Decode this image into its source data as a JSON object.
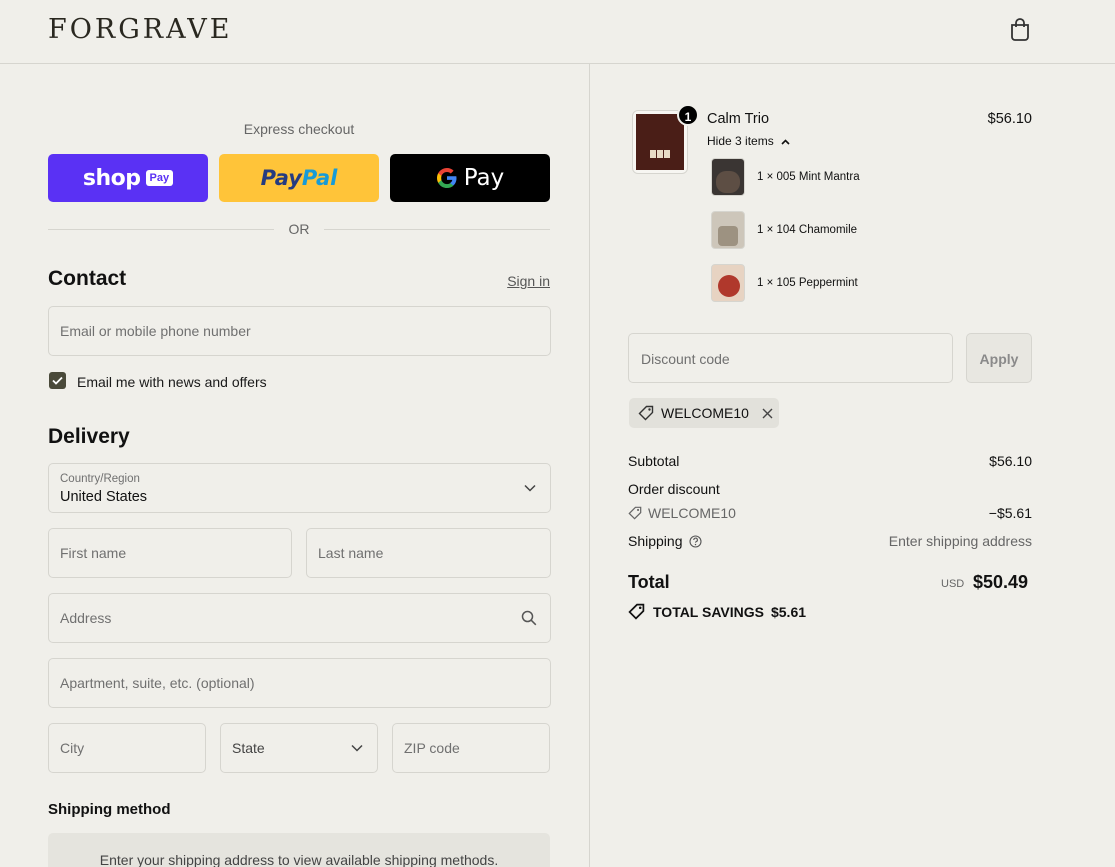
{
  "header": {
    "brand": "FORGRAVE"
  },
  "express": {
    "label": "Express checkout",
    "shop_word": "shop",
    "shop_pay": "Pay",
    "paypal_a": "Pay",
    "paypal_b": "Pal",
    "gpay_label": "Pay",
    "or_label": "OR"
  },
  "contact": {
    "title": "Contact",
    "sign_in": "Sign in",
    "email_placeholder": "Email or mobile phone number",
    "newsletter_label": "Email me with news and offers",
    "newsletter_checked": true
  },
  "delivery": {
    "title": "Delivery",
    "country_label": "Country/Region",
    "country_value": "United States",
    "first_name": "First name",
    "last_name": "Last name",
    "address": "Address",
    "apartment": "Apartment, suite, etc. (optional)",
    "city": "City",
    "state": "State",
    "zip": "ZIP code"
  },
  "shipping_method": {
    "title": "Shipping method",
    "note": "Enter your shipping address to view available shipping methods."
  },
  "order": {
    "product": {
      "name": "Calm Trio",
      "price": "$56.10",
      "quantity": "1",
      "toggle_label": "Hide 3 items",
      "items": [
        {
          "label": "1 × 005 Mint Mantra"
        },
        {
          "label": "1 × 104 Chamomile"
        },
        {
          "label": "1 × 105 Peppermint"
        }
      ]
    },
    "discount": {
      "placeholder": "Discount code",
      "apply_label": "Apply",
      "applied_code": "WELCOME10"
    },
    "summary": {
      "subtotal_label": "Subtotal",
      "subtotal_value": "$56.10",
      "order_discount_label": "Order discount",
      "discount_code": "WELCOME10",
      "discount_value": "−$5.61",
      "shipping_label": "Shipping",
      "shipping_value": "Enter shipping address",
      "total_label": "Total",
      "currency": "USD",
      "total_value": "$50.49",
      "savings_label": "TOTAL SAVINGS",
      "savings_value": "$5.61"
    }
  }
}
